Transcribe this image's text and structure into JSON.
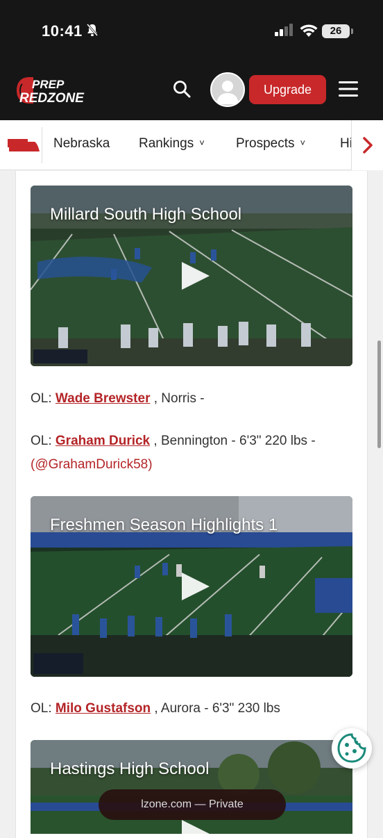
{
  "status_bar": {
    "time": "10:41",
    "battery": "26"
  },
  "header": {
    "logo_top": "PREP",
    "logo_bottom": "REDZONE",
    "upgrade_label": "Upgrade"
  },
  "subnav": {
    "items": [
      {
        "label": "Nebraska"
      },
      {
        "label": "Rankings",
        "chevron": "˅"
      },
      {
        "label": "Prospects",
        "chevron": "˅"
      },
      {
        "label": "Hi"
      }
    ]
  },
  "videos": [
    {
      "title": "Millard South High School"
    },
    {
      "title": "Freshmen Season Highlights 1"
    },
    {
      "title": "Hastings High School"
    }
  ],
  "players": [
    {
      "prefix": "OL:",
      "name": "Wade Brewster",
      "details": ", Norris -"
    },
    {
      "prefix": "OL:",
      "name": "Graham Durick",
      "details": ", Bennington - 6'3\" 220 lbs -",
      "handle": "(@GrahamDurick58)"
    },
    {
      "prefix": "OL:",
      "name": "Milo Gustafson",
      "details": ", Aurora - 6'3\" 230 lbs"
    }
  ],
  "url_bar": {
    "text": "lzone.com — Private"
  },
  "colors": {
    "brand_red": "#c8282a",
    "link_red": "#b42427",
    "header_bg": "#161616"
  }
}
